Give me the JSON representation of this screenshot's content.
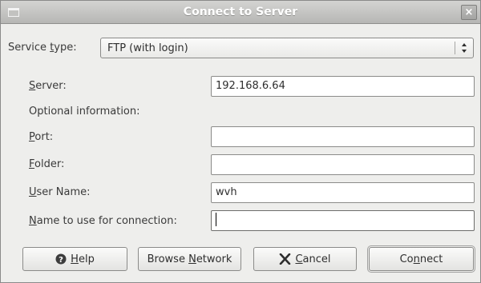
{
  "window": {
    "title": "Connect to Server",
    "close_glyph": "×"
  },
  "service_type": {
    "label_before": "Service ",
    "label_mnemonic": "t",
    "label_after": "ype:",
    "selected": "FTP (with login)"
  },
  "server": {
    "label_mnemonic": "S",
    "label_after": "erver:",
    "value": "192.168.6.64"
  },
  "optional_heading": "Optional information:",
  "port": {
    "label_mnemonic": "P",
    "label_after": "ort:",
    "value": ""
  },
  "folder": {
    "label_mnemonic": "F",
    "label_after": "older:",
    "value": ""
  },
  "user_name": {
    "label_mnemonic": "U",
    "label_after": "ser Name:",
    "value": "wvh"
  },
  "connection_name": {
    "label_mnemonic": "N",
    "label_after": "ame to use for connection:",
    "value": ""
  },
  "buttons": {
    "help": {
      "mnemonic": "H",
      "rest": "elp",
      "icon": "help-icon"
    },
    "browse": {
      "before": "Browse ",
      "mnemonic": "N",
      "rest": "etwork"
    },
    "cancel": {
      "mnemonic": "C",
      "rest": "ancel",
      "icon": "cancel-x-icon"
    },
    "connect": {
      "before": "Co",
      "mnemonic": "n",
      "rest": "nect"
    }
  }
}
